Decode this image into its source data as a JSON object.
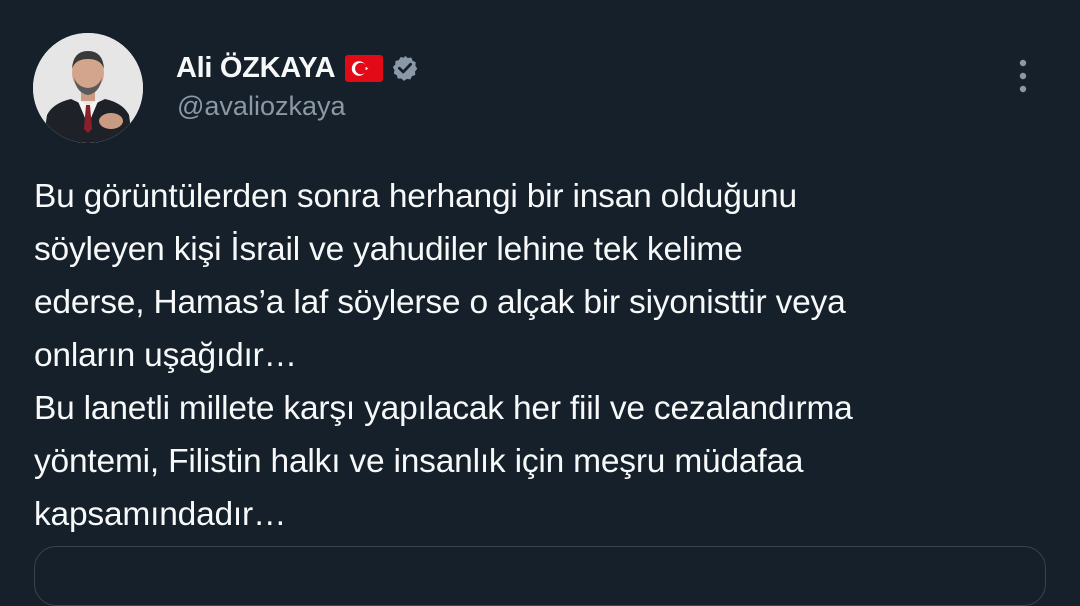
{
  "author": {
    "display_name": "Ali ÖZKAYA",
    "handle": "@avaliozkaya",
    "flag_icon": "turkey-flag-emoji",
    "verified_icon": "verified-badge-icon",
    "verified_color": "#8b98a5"
  },
  "tweet": {
    "lines": [
      "Bu görüntülerden sonra herhangi bir insan olduğunu",
      "söyleyen kişi İsrail ve yahudiler lehine tek kelime",
      "ederse, Hamas’a laf söylerse o alçak bir siyonisttir veya",
      "onların uşağıdır…",
      "Bu lanetli millete karşı yapılacak her fiil ve cezalandırma",
      "yöntemi, Filistin halkı ve insanlık için meşru müdafaa",
      "kapsamındadır…"
    ]
  },
  "menu": {
    "icon": "more-vertical-icon"
  },
  "colors": {
    "background": "#15202b",
    "text_primary": "#f7f9f9",
    "text_secondary": "#8b98a5",
    "border": "#38444d"
  }
}
